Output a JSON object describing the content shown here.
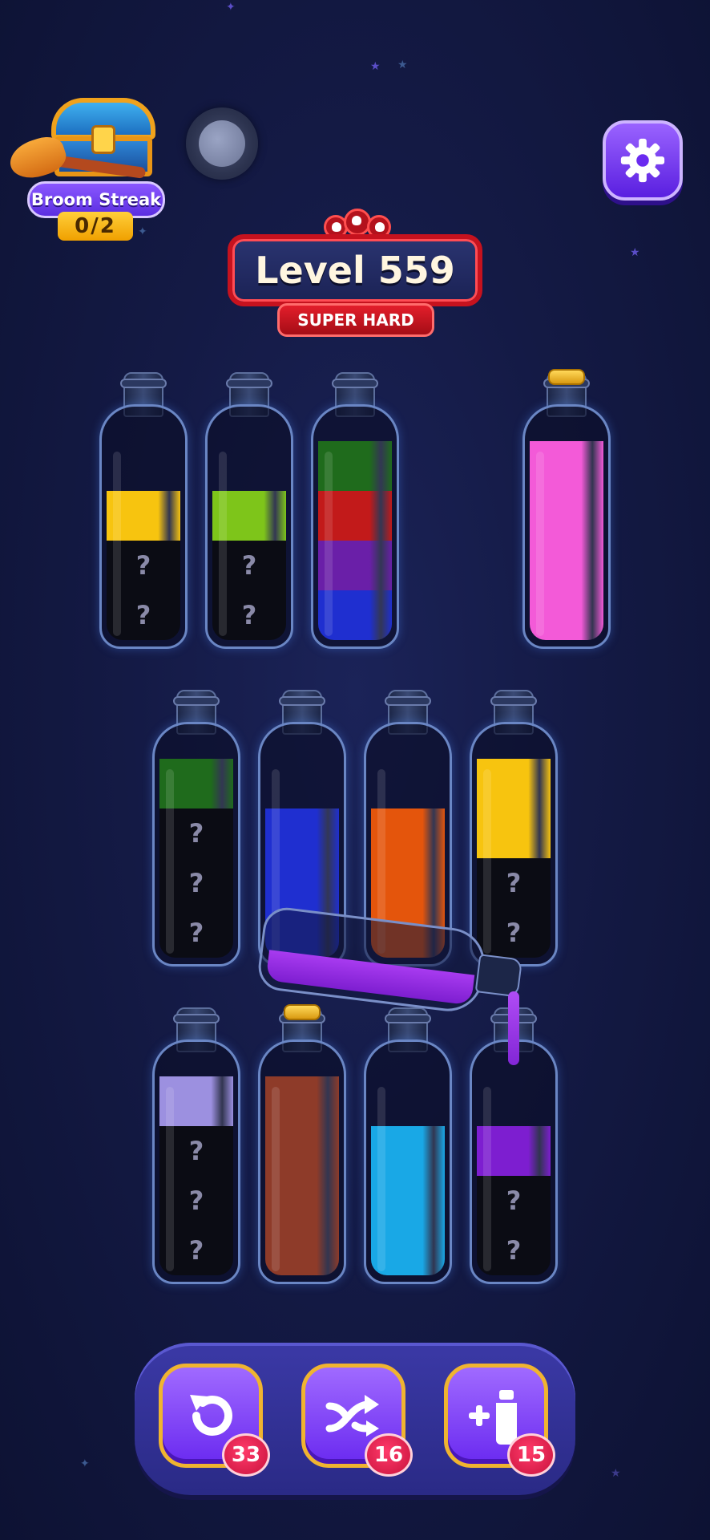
{
  "streak": {
    "title": "Broom Streak",
    "count": "0/2",
    "icon": "treasure-chest-icon"
  },
  "settings": {
    "icon": "gear-icon"
  },
  "level": {
    "label": "Level 559",
    "difficulty": "SUPER HARD",
    "icon": "skull-icon"
  },
  "hidden_mark": "?",
  "colors": {
    "yellow": "#f7c40f",
    "lime": "#7ec51a",
    "dark_green": "#1f6b1c",
    "red": "#c21a1a",
    "purple": "#6a1fa8",
    "blue": "#1f2fd0",
    "pink": "#f35ad8",
    "orange": "#e4550c",
    "lavender": "#9c90e0",
    "brown": "#8e3b29",
    "cyan": "#19a8e6",
    "violet": "#7d1ed0"
  },
  "bottles_top_row": [
    {
      "segments": [
        "hidden",
        "hidden",
        "yellow"
      ],
      "corked": false
    },
    {
      "segments": [
        "hidden",
        "hidden",
        "lime"
      ],
      "corked": false
    },
    {
      "segments": [
        "blue",
        "purple",
        "red",
        "dark_green"
      ],
      "corked": false
    },
    {
      "segments": [
        "pink",
        "pink",
        "pink",
        "pink"
      ],
      "corked": true
    }
  ],
  "bottles_middle_row": [
    {
      "segments": [
        "hidden",
        "hidden",
        "hidden",
        "dark_green"
      ],
      "corked": false
    },
    {
      "segments": [
        "blue",
        "blue",
        "blue"
      ],
      "corked": false
    },
    {
      "segments": [
        "orange",
        "orange",
        "orange"
      ],
      "corked": false
    },
    {
      "segments": [
        "hidden",
        "hidden",
        "yellow",
        "yellow"
      ],
      "corked": false
    }
  ],
  "bottles_bottom_row": [
    {
      "segments": [
        "hidden",
        "hidden",
        "hidden",
        "lavender"
      ],
      "corked": false
    },
    {
      "segments": [
        "brown",
        "brown",
        "brown",
        "brown"
      ],
      "corked": true
    },
    {
      "segments": [
        "cyan",
        "cyan",
        "cyan"
      ],
      "corked": false
    },
    {
      "segments": [
        "hidden",
        "hidden",
        "violet"
      ],
      "corked": false
    }
  ],
  "powerups": [
    {
      "name": "undo",
      "icon": "undo-icon",
      "count": "33"
    },
    {
      "name": "shuffle",
      "icon": "shuffle-icon",
      "count": "16"
    },
    {
      "name": "add-bottle",
      "icon": "add-bottle-icon",
      "count": "15"
    }
  ]
}
